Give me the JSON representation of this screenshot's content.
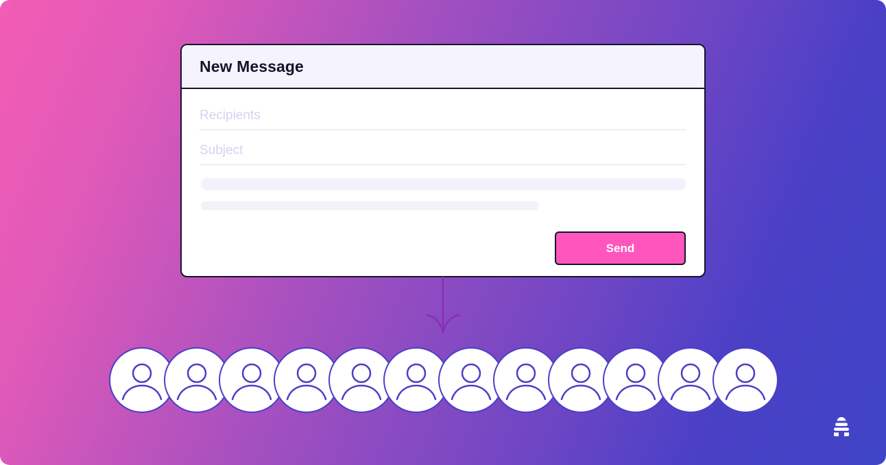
{
  "window": {
    "title": "New Message",
    "recipients_placeholder": "Recipients",
    "subject_placeholder": "Subject",
    "send_label": "Send"
  },
  "colors": {
    "accent_pink": "#ff56bd",
    "outline_dark": "#15142b",
    "avatar_stroke": "#4a3fc8",
    "arrow_purple": "#8b2db8"
  },
  "icons": {
    "arrow": "arrow-down-icon",
    "avatar": "user-icon",
    "logo": "beehive-logo-icon"
  },
  "recipients": [
    {
      "id": 1
    },
    {
      "id": 2
    },
    {
      "id": 3
    },
    {
      "id": 4
    },
    {
      "id": 5
    },
    {
      "id": 6
    },
    {
      "id": 7
    },
    {
      "id": 8
    },
    {
      "id": 9
    },
    {
      "id": 10
    },
    {
      "id": 11
    },
    {
      "id": 12
    }
  ]
}
